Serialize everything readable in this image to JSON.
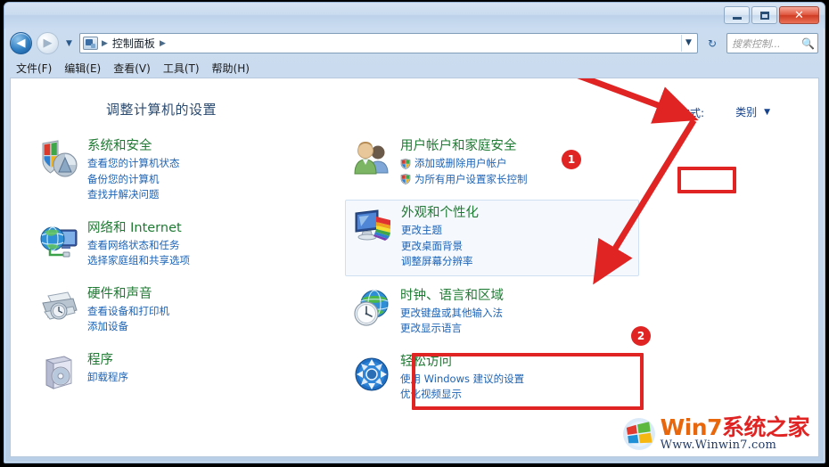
{
  "window": {
    "title": "控制面板",
    "buttons": {
      "minimize": "—",
      "maximize": "□",
      "close": "✕"
    }
  },
  "addressbar": {
    "back_glyph": "◀",
    "forward_glyph": "▶",
    "history_caret": "▼",
    "breadcrumb_root": "控制面板",
    "separator": "▶",
    "dropdown_caret": "▼",
    "refresh_glyph": "↻",
    "icon": "control-panel-icon"
  },
  "search": {
    "placeholder": "搜索控制...",
    "icon": "search-icon"
  },
  "menubar": {
    "items": [
      {
        "label": "文件(F)"
      },
      {
        "label": "编辑(E)"
      },
      {
        "label": "查看(V)"
      },
      {
        "label": "工具(T)"
      },
      {
        "label": "帮助(H)"
      }
    ]
  },
  "main": {
    "page_title": "调整计算机的设置",
    "view_by_label": "查看方式:",
    "view_by_value": "类别",
    "view_by_caret": "▼"
  },
  "categories_left": [
    {
      "title": "系统和安全",
      "icon": "security-shield-icon",
      "links": [
        {
          "label": "查看您的计算机状态"
        },
        {
          "label": "备份您的计算机"
        },
        {
          "label": "查找并解决问题"
        }
      ]
    },
    {
      "title": "网络和 Internet",
      "icon": "network-globe-icon",
      "links": [
        {
          "label": "查看网络状态和任务"
        },
        {
          "label": "选择家庭组和共享选项"
        }
      ]
    },
    {
      "title": "硬件和声音",
      "icon": "printer-device-icon",
      "links": [
        {
          "label": "查看设备和打印机"
        },
        {
          "label": "添加设备"
        }
      ]
    },
    {
      "title": "程序",
      "icon": "programs-box-icon",
      "links": [
        {
          "label": "卸载程序"
        }
      ]
    }
  ],
  "categories_right": [
    {
      "title": "用户帐户和家庭安全",
      "icon": "user-accounts-icon",
      "links": [
        {
          "label": "添加或删除用户帐户",
          "shield": true
        },
        {
          "label": "为所有用户设置家长控制",
          "shield": true
        }
      ]
    },
    {
      "title": "外观和个性化",
      "icon": "appearance-monitor-icon",
      "hover": true,
      "links": [
        {
          "label": "更改主题"
        },
        {
          "label": "更改桌面背景"
        },
        {
          "label": "调整屏幕分辨率"
        }
      ]
    },
    {
      "title": "时钟、语言和区域",
      "icon": "clock-globe-icon",
      "highlighted": true,
      "links": [
        {
          "label": "更改键盘或其他输入法"
        },
        {
          "label": "更改显示语言"
        }
      ]
    },
    {
      "title": "轻松访问",
      "icon": "ease-of-access-icon",
      "links": [
        {
          "label": "使用 Windows 建议的设置"
        },
        {
          "label": "优化视频显示"
        }
      ]
    }
  ],
  "annotations": {
    "accent_color": "#e02424",
    "badges": [
      {
        "label": "1"
      },
      {
        "label": "2"
      }
    ]
  },
  "watermark": {
    "brand_latin": "Win7",
    "brand_cn": "系统之家",
    "url": "Www.Winwin7.com",
    "logo": "windows-logo-icon"
  }
}
